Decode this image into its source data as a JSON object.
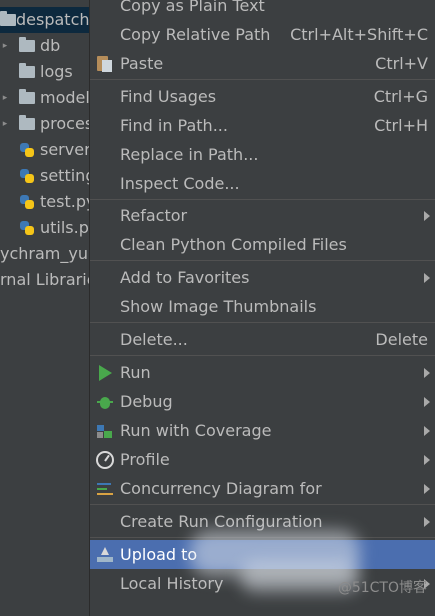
{
  "tree": {
    "items": [
      {
        "label": "despatch_",
        "type": "folder",
        "arrow": "▾",
        "selected": true
      },
      {
        "label": "db",
        "type": "folder",
        "arrow": "▸"
      },
      {
        "label": "logs",
        "type": "folder",
        "arrow": ""
      },
      {
        "label": "model",
        "type": "folder",
        "arrow": "▸"
      },
      {
        "label": "proces",
        "type": "folder",
        "arrow": "▸"
      },
      {
        "label": "server_",
        "type": "py",
        "arrow": ""
      },
      {
        "label": "setting",
        "type": "py",
        "arrow": ""
      },
      {
        "label": "test.py",
        "type": "py",
        "arrow": ""
      },
      {
        "label": "utils.py",
        "type": "py",
        "arrow": ""
      },
      {
        "label": "ychram_yun",
        "type": "text",
        "arrow": ""
      },
      {
        "label": "rnal Librarie",
        "type": "text",
        "arrow": ""
      }
    ]
  },
  "menu": {
    "items": [
      {
        "label": "Copy as Plain Text",
        "shortcut": "",
        "icon": ""
      },
      {
        "label": "Copy Relative Path",
        "shortcut": "Ctrl+Alt+Shift+C",
        "icon": ""
      },
      {
        "label": "Paste",
        "shortcut": "Ctrl+V",
        "icon": "paste-icon"
      },
      {
        "label": "Find Usages",
        "shortcut": "Ctrl+G",
        "icon": ""
      },
      {
        "label": "Find in Path...",
        "shortcut": "Ctrl+H",
        "icon": ""
      },
      {
        "label": "Replace in Path...",
        "shortcut": "",
        "icon": ""
      },
      {
        "label": "Inspect Code...",
        "shortcut": "",
        "icon": ""
      },
      {
        "label": "Refactor",
        "shortcut": "",
        "icon": "",
        "submenu": true
      },
      {
        "label": "Clean Python Compiled Files",
        "shortcut": "",
        "icon": ""
      },
      {
        "label": "Add to Favorites",
        "shortcut": "",
        "icon": "",
        "submenu": true
      },
      {
        "label": "Show Image Thumbnails",
        "shortcut": "",
        "icon": ""
      },
      {
        "label": "Delete...",
        "shortcut": "Delete",
        "icon": ""
      },
      {
        "label": "Run",
        "shortcut": "",
        "icon": "run-icon",
        "submenu": true
      },
      {
        "label": "Debug",
        "shortcut": "",
        "icon": "debug-icon",
        "submenu": true
      },
      {
        "label": "Run with Coverage",
        "shortcut": "",
        "icon": "coverage-icon",
        "submenu": true
      },
      {
        "label": "Profile",
        "shortcut": "",
        "icon": "profile-icon",
        "submenu": true
      },
      {
        "label": "Concurrency Diagram for",
        "shortcut": "",
        "icon": "concurrency-icon",
        "submenu": true
      },
      {
        "label": "Create Run Configuration",
        "shortcut": "",
        "icon": "",
        "submenu": true
      },
      {
        "label": "Upload to",
        "shortcut": "",
        "icon": "upload-icon",
        "highlighted": true
      },
      {
        "label": "Local History",
        "shortcut": "",
        "icon": "",
        "submenu": true
      }
    ]
  },
  "watermark": "@51CTO博客",
  "colors": {
    "menu_bg": "#3c3f41",
    "highlight": "#4b6eaf",
    "selection": "#0d293e",
    "text": "#bbbbbb"
  }
}
